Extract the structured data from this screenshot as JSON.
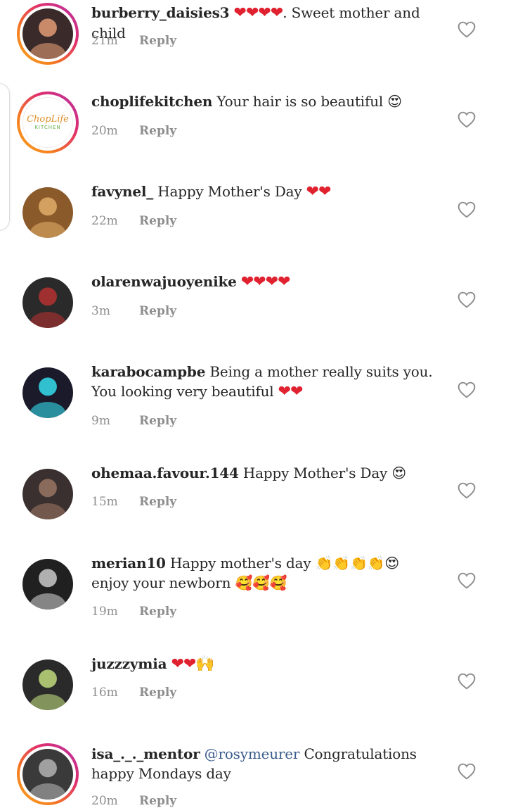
{
  "comments": [
    {
      "username": "burberry_daisies3",
      "text": ". Sweet mother and child",
      "pre_emoji": "❤❤❤❤",
      "time": "21m",
      "reply": "Reply",
      "avatar": "woman-portrait",
      "story": true,
      "colors": [
        "#3a2a2a",
        "#c98a6a"
      ]
    },
    {
      "username": "choplifekitchen",
      "text": "Your hair is so beautiful",
      "emoji": "😍",
      "time": "20m",
      "reply": "Reply",
      "avatar": "choplife-logo",
      "story": true,
      "logo_text": "ChopLife",
      "logo_sub": "KITCHEN"
    },
    {
      "username": "favynel_",
      "text": "Happy Mother's Day",
      "emoji": "❤❤",
      "time": "22m",
      "reply": "Reply",
      "avatar": "curly-hair-portrait",
      "story": false,
      "colors": [
        "#8a5a2a",
        "#d4a060"
      ]
    },
    {
      "username": "olarenwajuoyenike",
      "text": "",
      "emoji": "❤❤❤❤",
      "time": "3m",
      "reply": "Reply",
      "avatar": "dress-photo",
      "story": false,
      "colors": [
        "#2a2a2a",
        "#a03030"
      ]
    },
    {
      "username": "karabocampbe",
      "text": "Being a mother really suits you. You looking very beautiful",
      "emoji": "❤❤",
      "time": "9m",
      "reply": "Reply",
      "avatar": "art-portrait",
      "story": false,
      "colors": [
        "#1a1a2a",
        "#30c0d0"
      ]
    },
    {
      "username": "ohemaa.favour.144",
      "text": "Happy Mother's Day",
      "emoji": "😍",
      "time": "15m",
      "reply": "Reply",
      "avatar": "selfie-portrait",
      "story": false,
      "colors": [
        "#3a3030",
        "#8a6a5a"
      ]
    },
    {
      "username": "merian10",
      "text": "Happy mother's day",
      "emoji": "👏👏👏👏😍",
      "text2": "enjoy your newborn",
      "emoji2": "🥰🥰🥰",
      "time": "19m",
      "reply": "Reply",
      "avatar": "bw-portrait",
      "story": false,
      "colors": [
        "#202020",
        "#b0b0b0"
      ]
    },
    {
      "username": "juzzzymia",
      "text": "",
      "emoji": "❤❤🙌",
      "time": "16m",
      "reply": "Reply",
      "avatar": "portrait-green",
      "story": false,
      "colors": [
        "#2a2a2a",
        "#a8c070"
      ]
    },
    {
      "username": "isa_._._mentor",
      "mention": "@rosymeurer",
      "text": "Congratulations happy Mondays day",
      "time": "20m",
      "reply": "Reply",
      "avatar": "man-portrait",
      "story": true,
      "colors": [
        "#3a3a3a",
        "#a0a0a0"
      ]
    }
  ]
}
